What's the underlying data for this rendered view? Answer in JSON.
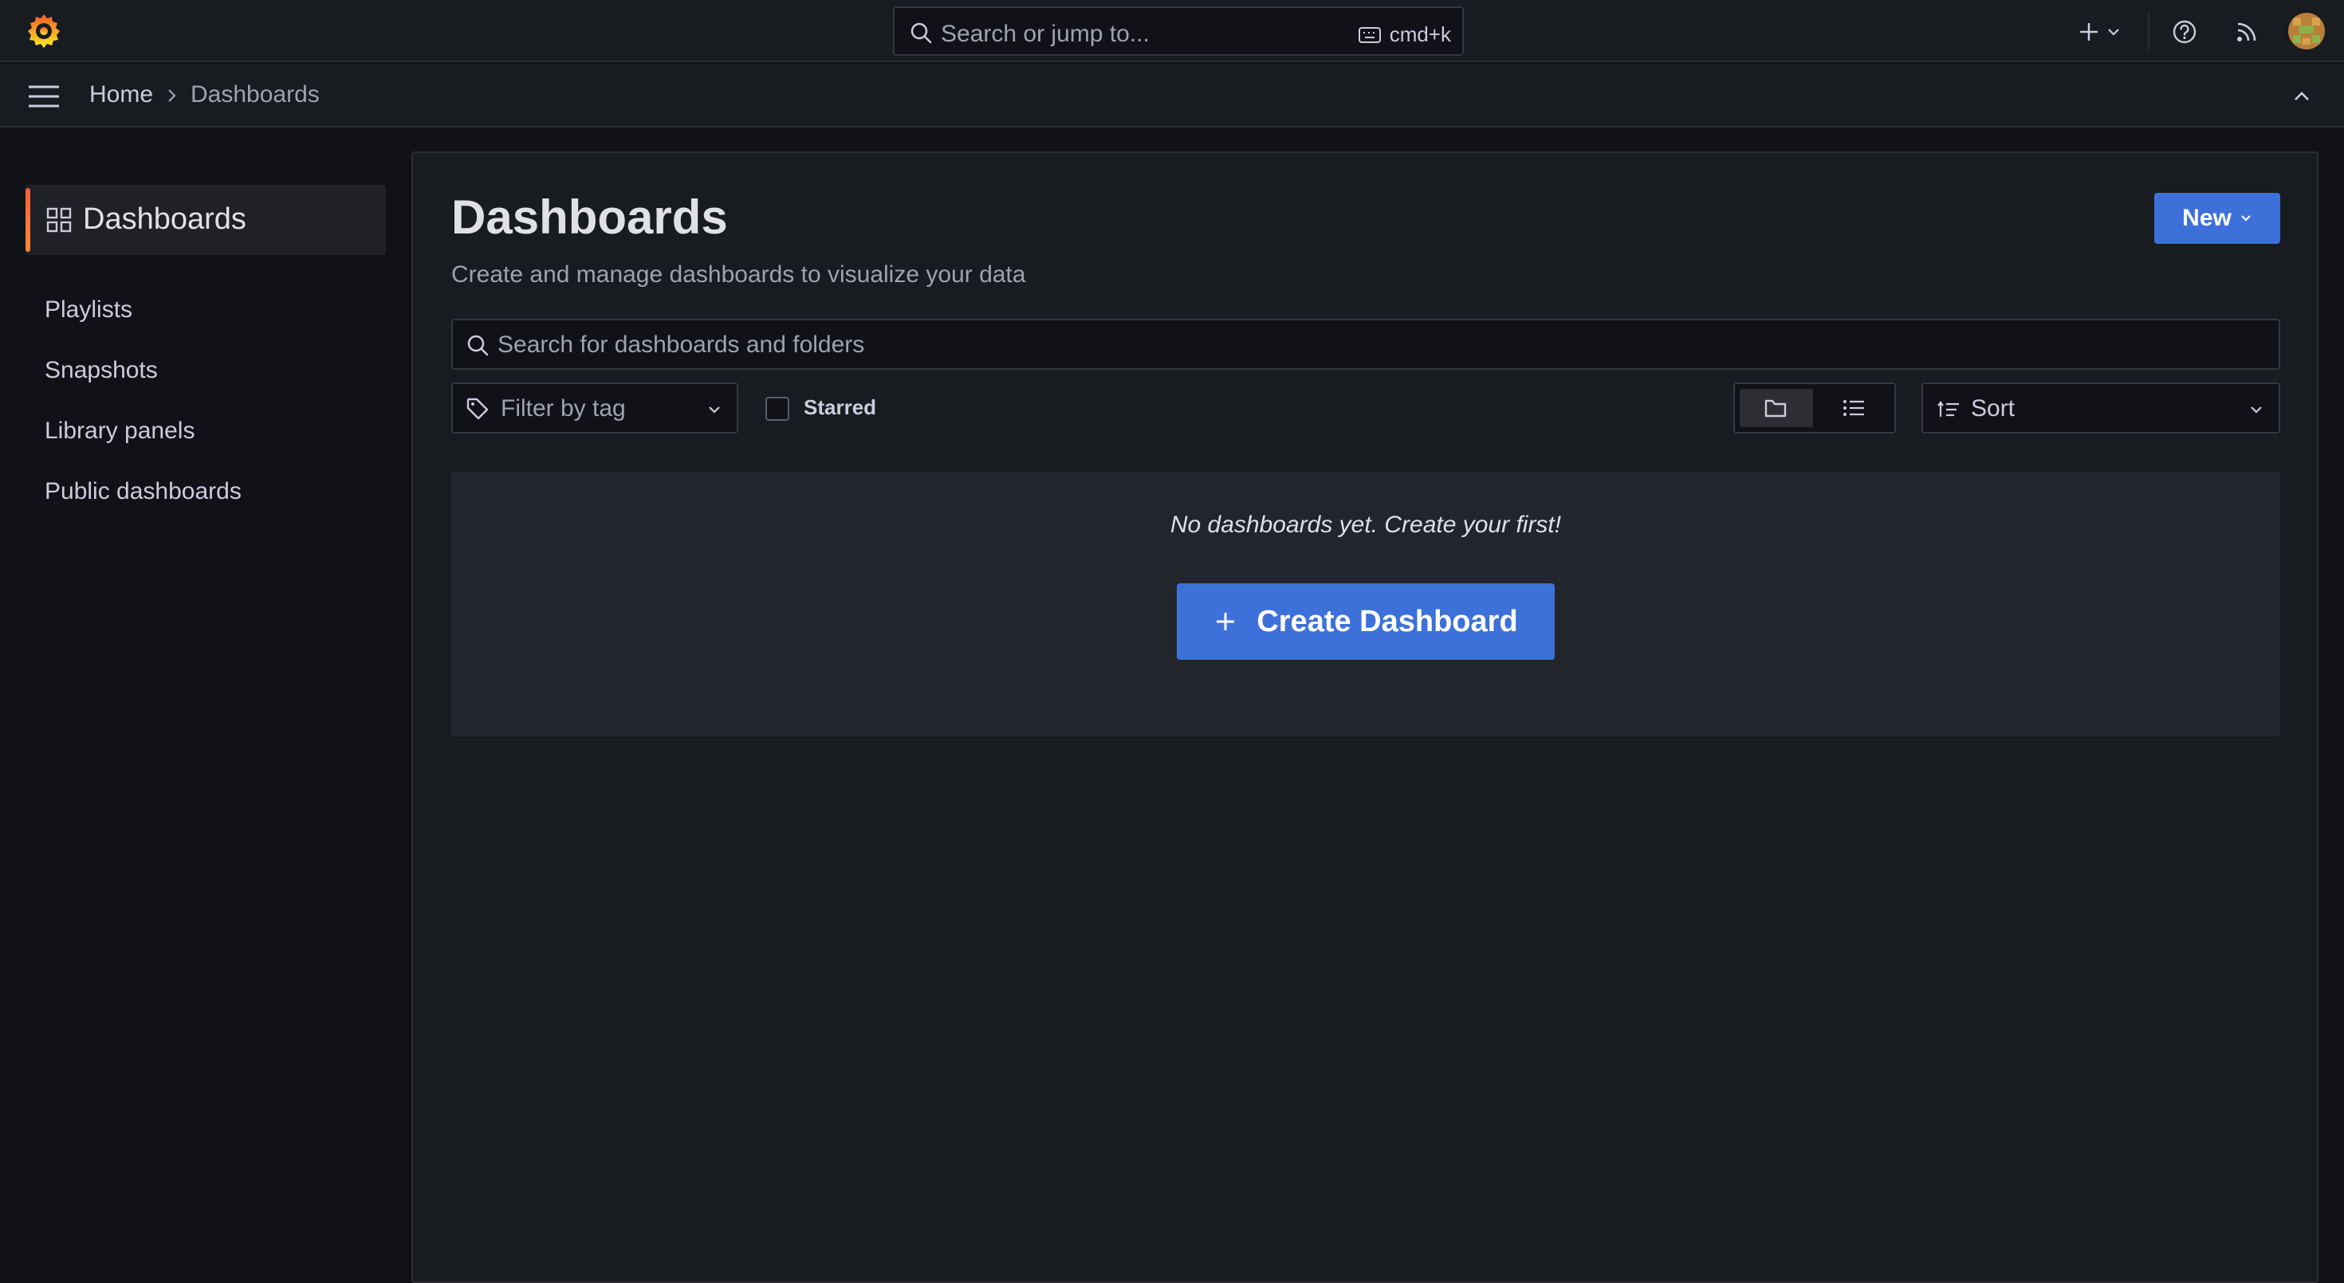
{
  "topbar": {
    "search_placeholder": "Search or jump to...",
    "shortcut": "cmd+k"
  },
  "breadcrumb": {
    "home": "Home",
    "current": "Dashboards"
  },
  "sidebar": {
    "active": "Dashboards",
    "items": [
      {
        "label": "Playlists"
      },
      {
        "label": "Snapshots"
      },
      {
        "label": "Library panels"
      },
      {
        "label": "Public dashboards"
      }
    ]
  },
  "main": {
    "title": "Dashboards",
    "subtitle": "Create and manage dashboards to visualize your data",
    "new_label": "New",
    "search_placeholder": "Search for dashboards and folders",
    "tag_filter": "Filter by tag",
    "starred_label": "Starred",
    "sort_label": "Sort",
    "empty_text": "No dashboards yet. Create your first!",
    "create_label": "Create Dashboard"
  },
  "colors": {
    "accent": "#3d71d9",
    "active_bar": "#f55f3e",
    "background": "#111217",
    "panel": "#181b1f"
  },
  "icons": [
    "grafana-logo-icon",
    "search-icon",
    "keyboard-icon",
    "plus-icon",
    "chevron-down-icon",
    "help-icon",
    "rss-icon",
    "menu-icon",
    "chevron-right-icon",
    "chevron-up-icon",
    "grid-icon",
    "tag-icon",
    "folder-icon",
    "list-icon",
    "sort-icon"
  ]
}
